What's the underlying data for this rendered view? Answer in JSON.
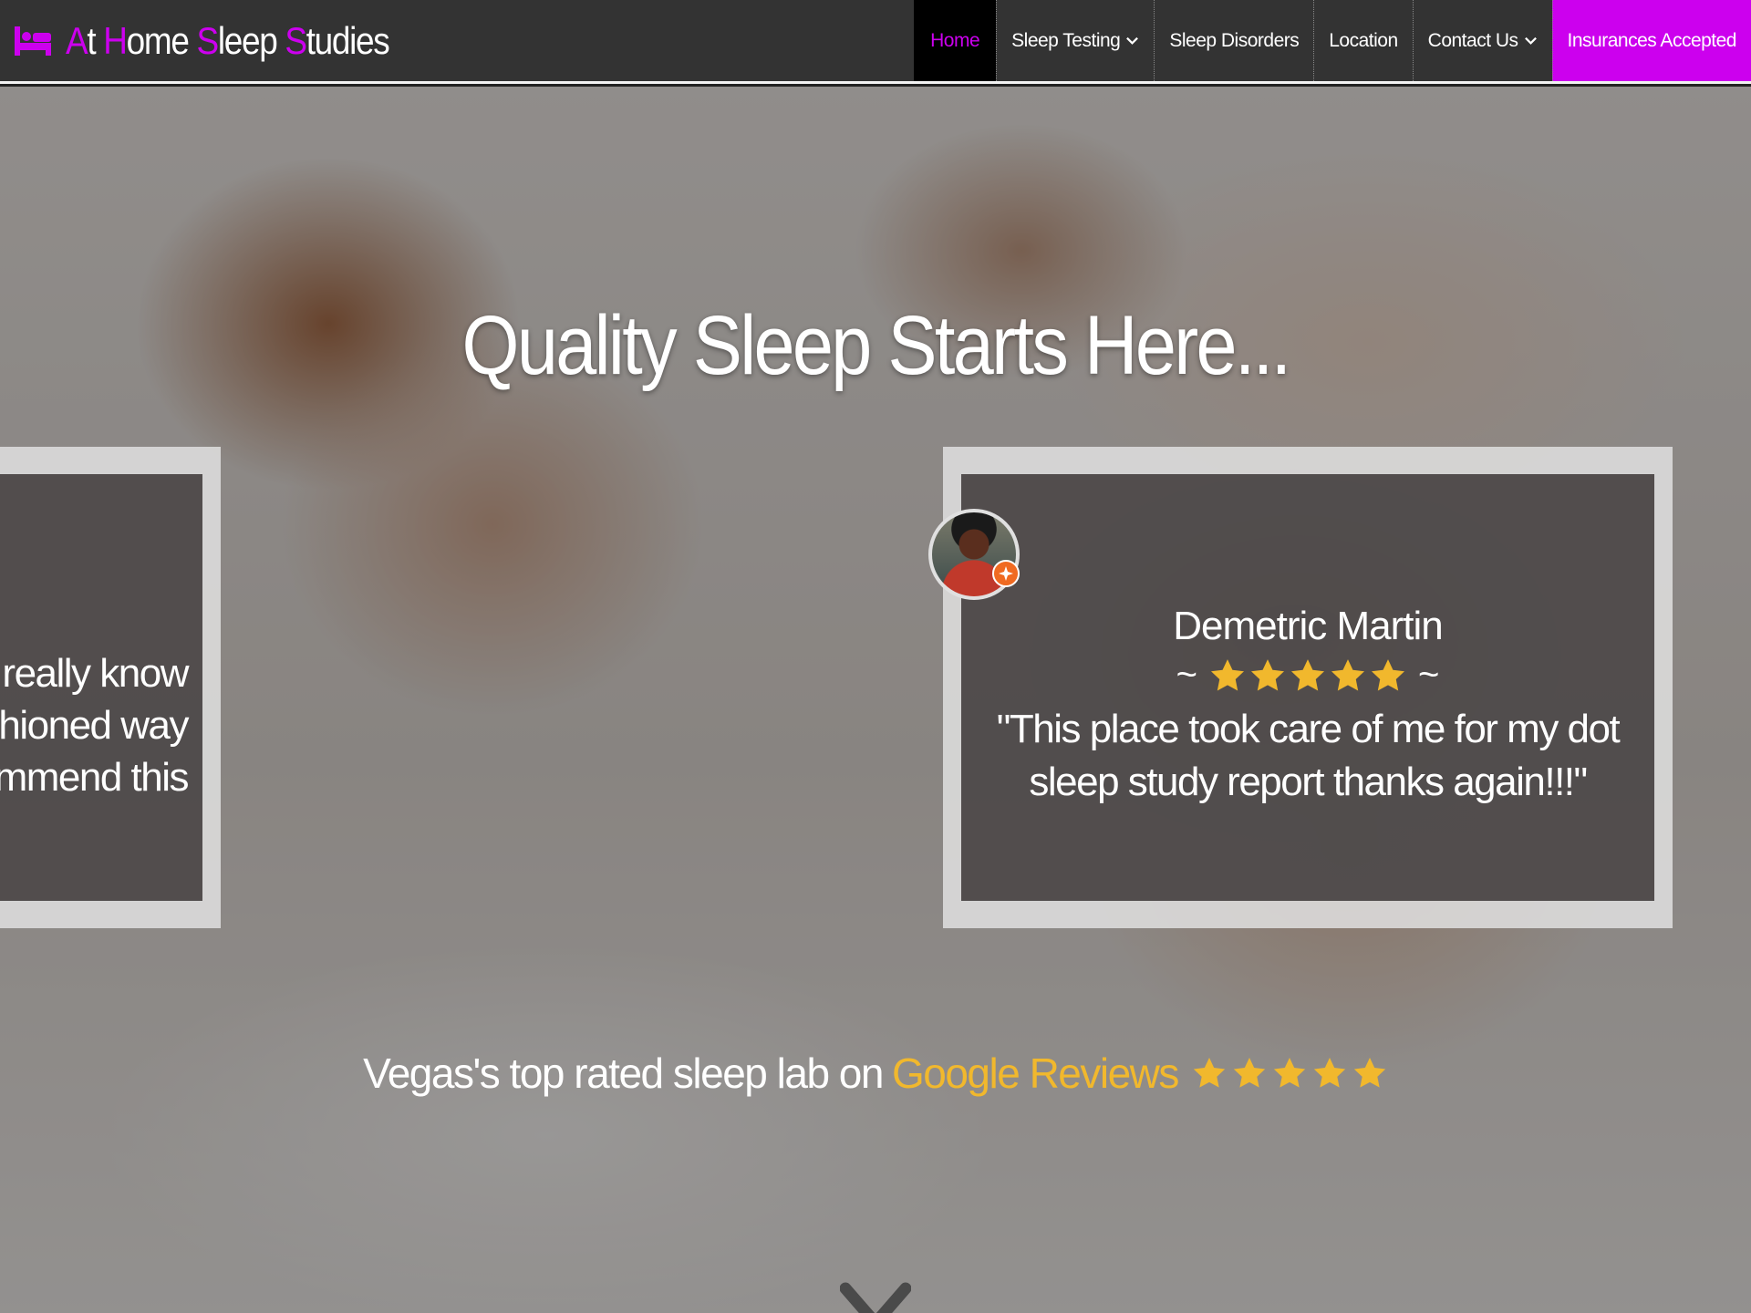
{
  "brand": {
    "icon": "bed-icon",
    "parts": [
      {
        "cap": "A",
        "rest": "t "
      },
      {
        "cap": "H",
        "rest": "ome "
      },
      {
        "cap": "S",
        "rest": "leep "
      },
      {
        "cap": "S",
        "rest": "tudies"
      }
    ]
  },
  "nav": {
    "items": [
      {
        "label": "Home",
        "state": "active"
      },
      {
        "label": "Sleep Testing",
        "dropdown": true
      },
      {
        "label": "Sleep Disorders"
      },
      {
        "label": "Location"
      },
      {
        "label": "Contact Us",
        "dropdown": true
      },
      {
        "label": "Insurances Accepted",
        "state": "accent"
      }
    ]
  },
  "hero": {
    "title": "Quality Sleep Starts Here...",
    "left_card_text": "ey really know\nashioned way\ncommend this",
    "review": {
      "name": "Demetric Martin",
      "tilde_left": "~",
      "tilde_right": "~",
      "stars": 5,
      "text": "\"This place took care of me for my dot sleep study report thanks again!!!\""
    },
    "google": {
      "prefix": "Vegas's top rated sleep lab on ",
      "highlight": "Google Reviews",
      "stars": 5
    }
  },
  "colors": {
    "brand_accent": "#cc00ee",
    "navbar_bg": "#333333",
    "star": "#f1b82d"
  }
}
